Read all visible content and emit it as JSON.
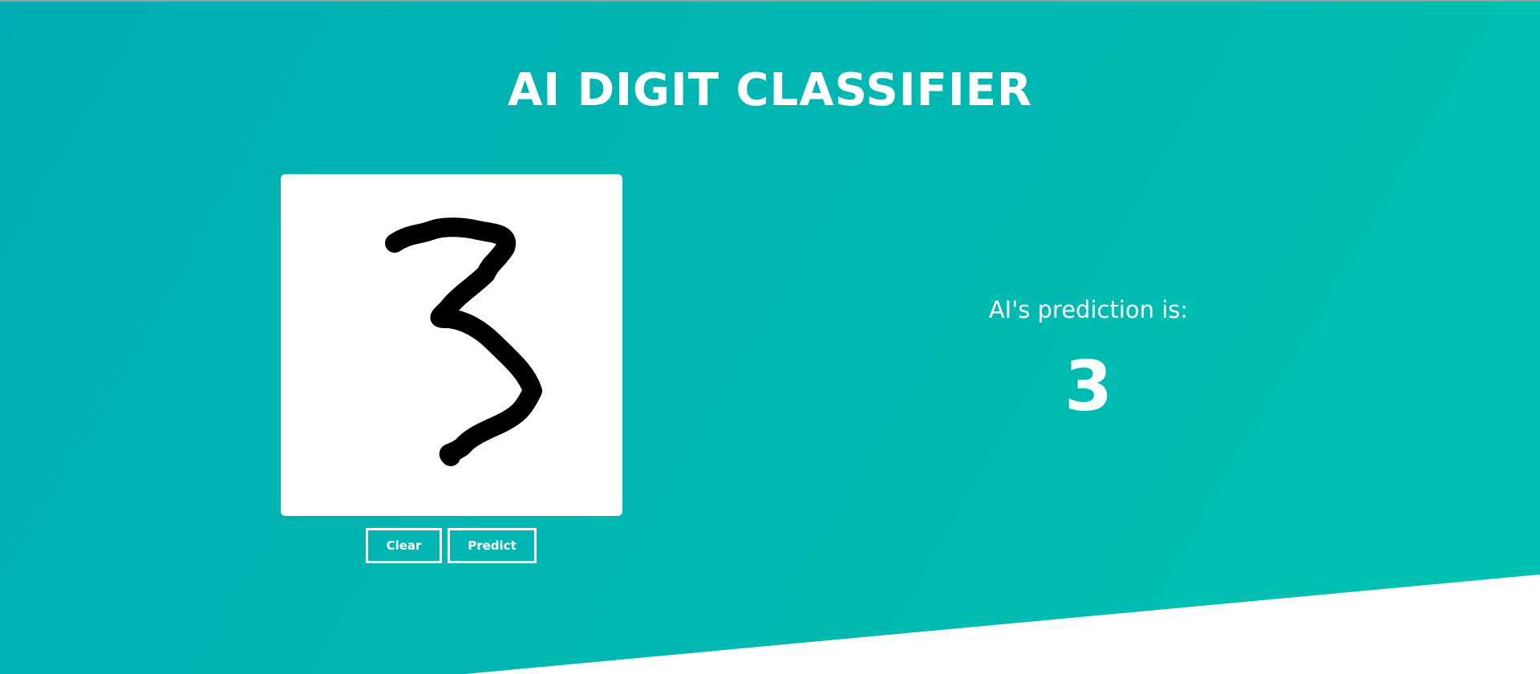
{
  "header": {
    "title": "AI DIGIT CLASSIFIER"
  },
  "canvas": {
    "drawn_digit": "3"
  },
  "buttons": {
    "clear_label": "Clear",
    "predict_label": "Predict"
  },
  "prediction": {
    "label": "AI's prediction is:",
    "value": "3"
  },
  "colors": {
    "gradient_start": "#00adb2",
    "gradient_end": "#00c2b1",
    "text": "#ffffff",
    "canvas_bg": "#ffffff",
    "stroke": "#000000"
  }
}
